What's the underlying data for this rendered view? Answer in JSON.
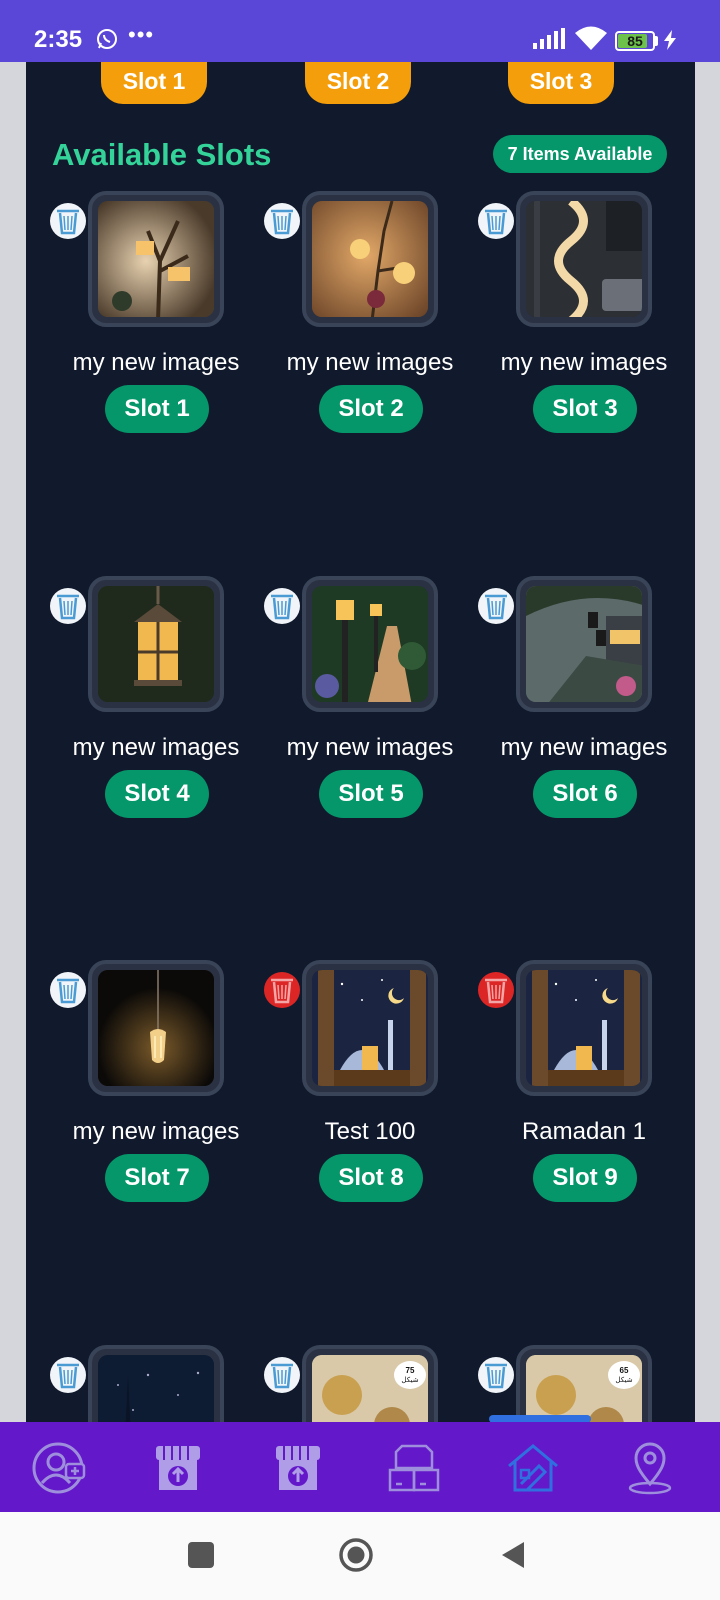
{
  "status_bar": {
    "time": "2:35",
    "battery": "85"
  },
  "top_slots": [
    "Slot 1",
    "Slot 2",
    "Slot 3"
  ],
  "section": {
    "title": "Available Slots",
    "count_badge": "7 Items Available"
  },
  "cards": [
    {
      "title": "my new images",
      "slot": "Slot 1",
      "scene": "branch-lamp"
    },
    {
      "title": "my new images",
      "slot": "Slot 2",
      "scene": "wall-lamps"
    },
    {
      "title": "my new images",
      "slot": "Slot 3",
      "scene": "spiral-lamp"
    },
    {
      "title": "my new images",
      "slot": "Slot 4",
      "scene": "lantern"
    },
    {
      "title": "my new images",
      "slot": "Slot 5",
      "scene": "garden-path"
    },
    {
      "title": "my new images",
      "slot": "Slot 6",
      "scene": "street-lanterns"
    },
    {
      "title": "my new images",
      "slot": "Slot 7",
      "scene": "bulb"
    },
    {
      "title": "Test 100",
      "slot": "Slot 8",
      "scene": "ramadan"
    },
    {
      "title": "Ramadan 1",
      "slot": "Slot 9",
      "scene": "ramadan"
    }
  ],
  "partial_cards": [
    {
      "scene": "night-sky"
    },
    {
      "scene": "shop-75",
      "price": "75",
      "currency": "شيكل"
    },
    {
      "scene": "shop-65",
      "price": "65",
      "currency": "شيكل"
    }
  ],
  "colors": {
    "panel_bg": "#111a2c",
    "accent_green": "#059669",
    "title_green": "#34d399",
    "orange": "#f59e0b",
    "nav_bg": "#6319c9",
    "status_bg": "#5b47d7"
  },
  "bottom_nav": [
    {
      "icon": "add-user-icon",
      "active": false
    },
    {
      "icon": "store-upload-icon",
      "active": false
    },
    {
      "icon": "store-upload-icon",
      "active": false
    },
    {
      "icon": "boxes-icon",
      "active": false
    },
    {
      "icon": "home-design-icon",
      "active": true
    },
    {
      "icon": "location-pin-icon",
      "active": false
    }
  ]
}
